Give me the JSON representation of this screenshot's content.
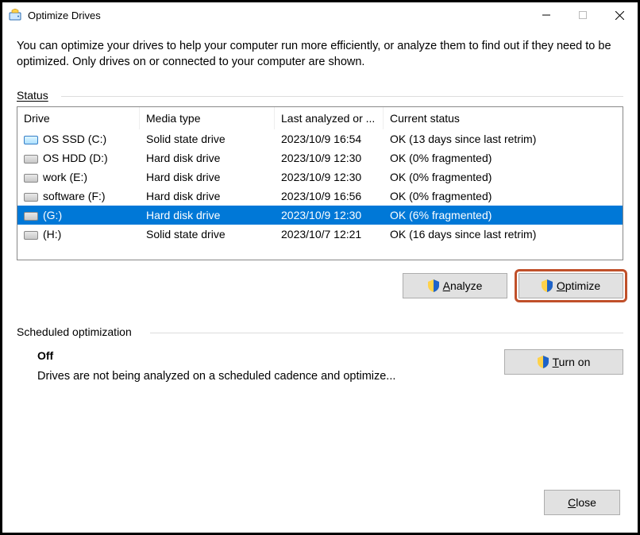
{
  "window": {
    "title": "Optimize Drives"
  },
  "intro": "You can optimize your drives to help your computer run more efficiently, or analyze them to find out if they need to be optimized. Only drives on or connected to your computer are shown.",
  "status_label": "Status",
  "columns": {
    "drive": "Drive",
    "media": "Media type",
    "last": "Last analyzed or ...",
    "status": "Current status"
  },
  "drives": [
    {
      "name": "OS SSD (C:)",
      "icon": "ssd",
      "media": "Solid state drive",
      "last": "2023/10/9 16:54",
      "status": "OK (13 days since last retrim)",
      "selected": false
    },
    {
      "name": "OS HDD (D:)",
      "icon": "hdd",
      "media": "Hard disk drive",
      "last": "2023/10/9 12:30",
      "status": "OK (0% fragmented)",
      "selected": false
    },
    {
      "name": "work (E:)",
      "icon": "hdd",
      "media": "Hard disk drive",
      "last": "2023/10/9 12:30",
      "status": "OK (0% fragmented)",
      "selected": false
    },
    {
      "name": "software (F:)",
      "icon": "hdd",
      "media": "Hard disk drive",
      "last": "2023/10/9 16:56",
      "status": "OK (0% fragmented)",
      "selected": false
    },
    {
      "name": "(G:)",
      "icon": "hdd",
      "media": "Hard disk drive",
      "last": "2023/10/9 12:30",
      "status": "OK (6% fragmented)",
      "selected": true
    },
    {
      "name": "(H:)",
      "icon": "hdd",
      "media": "Solid state drive",
      "last": "2023/10/7 12:21",
      "status": "OK (16 days since last retrim)",
      "selected": false
    }
  ],
  "buttons": {
    "analyze": "Analyze",
    "optimize": "Optimize",
    "turn_on": "Turn on",
    "close": "Close"
  },
  "scheduled": {
    "label": "Scheduled optimization",
    "state": "Off",
    "desc": "Drives are not being analyzed on a scheduled cadence and optimize..."
  }
}
